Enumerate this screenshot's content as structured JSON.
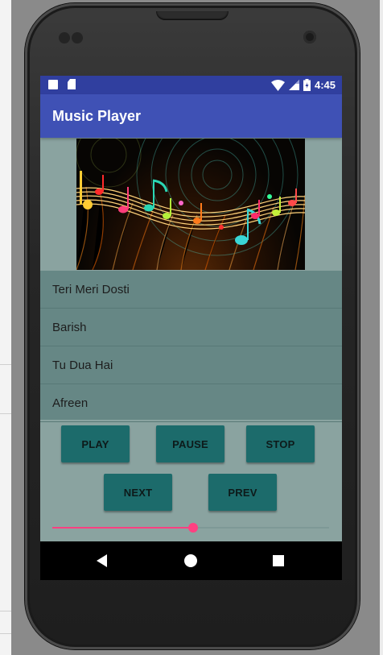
{
  "app": {
    "title": "Music Player"
  },
  "status_bar": {
    "time": "4:45"
  },
  "songs": [
    "Teri Meri Dosti",
    "Barish",
    "Tu Dua Hai",
    "Afreen"
  ],
  "controls": {
    "play": "PLAY",
    "pause": "PAUSE",
    "stop": "STOP",
    "next": "NEXT",
    "prev": "PREV"
  },
  "seekbar": {
    "progress": 0.51
  },
  "colors": {
    "status_bar": "#303f9f",
    "app_bar": "#3f51b5",
    "button": "#1c6b6b",
    "accent": "#ff4081",
    "list_bg": "#668785",
    "screen_bg": "#8aa3a0"
  },
  "icons": [
    "notification-square-icon",
    "sd-card-icon",
    "wifi-icon",
    "cell-signal-icon",
    "battery-icon",
    "back-icon",
    "home-icon",
    "recents-icon"
  ]
}
